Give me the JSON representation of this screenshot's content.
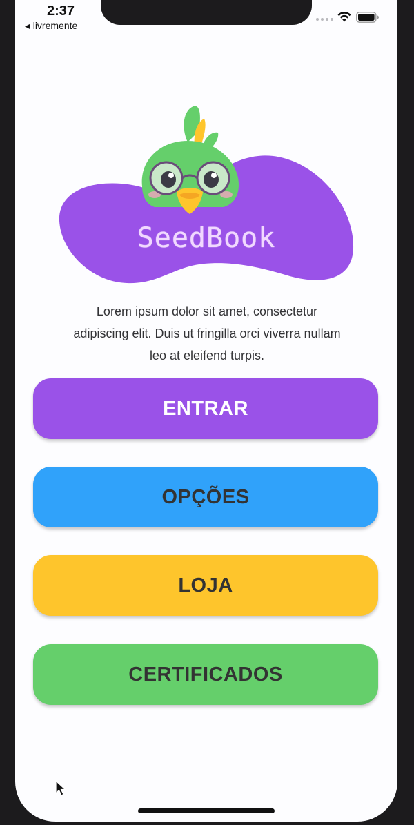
{
  "status_bar": {
    "time": "2:37",
    "back_app": "livremente",
    "back_arrow": "◀"
  },
  "brand": {
    "name": "SeedBook",
    "mascot": "green-parrot-with-glasses",
    "blob_color": "#9a52e8"
  },
  "description": "Lorem ipsum dolor sit amet, consectetur adipiscing elit. Duis ut fringilla orci viverra nullam leo at eleifend turpis.",
  "menu": {
    "buttons": [
      {
        "label": "ENTRAR",
        "color": "#9a52e8"
      },
      {
        "label": "OPÇÕES",
        "color": "#30a2fa"
      },
      {
        "label": "LOJA",
        "color": "#fec52c"
      },
      {
        "label": "CERTIFICADOS",
        "color": "#65cf6b"
      }
    ]
  },
  "colors": {
    "background": "#fdfdff",
    "frame": "#1c1b1d",
    "button_text_dark": "#333333"
  },
  "icons": [
    "wifi-icon",
    "battery-icon",
    "signal-icon",
    "mouse-cursor-icon"
  ]
}
